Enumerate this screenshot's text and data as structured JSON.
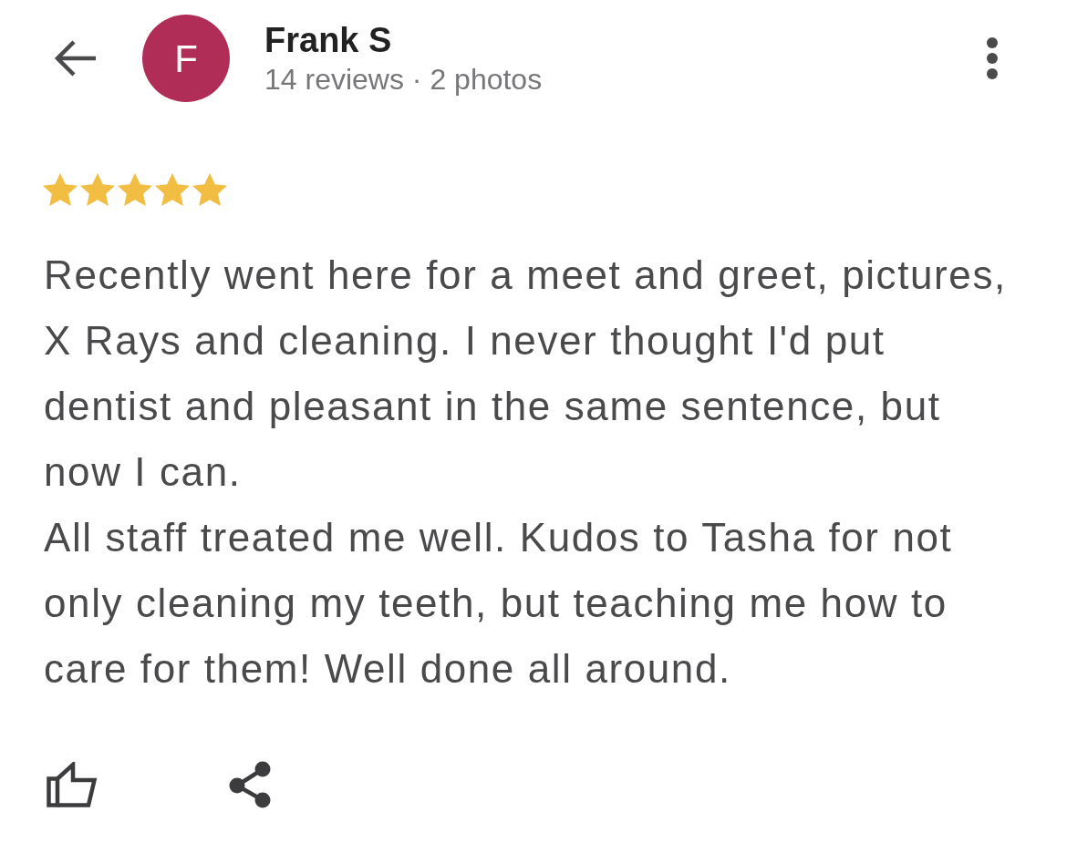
{
  "header": {
    "avatar_letter": "F",
    "name": "Frank S",
    "subtitle": "14 reviews · 2 photos"
  },
  "review": {
    "stars": 5,
    "paragraphs": [
      "Recently went here for a meet and greet, pictures, X Rays and cleaning. I never thought I'd put dentist and pleasant in the same sentence, but now I can.",
      "All staff treated me well. Kudos to Tasha for not only cleaning my teeth, but teaching me how to care for them! Well done all around."
    ]
  }
}
